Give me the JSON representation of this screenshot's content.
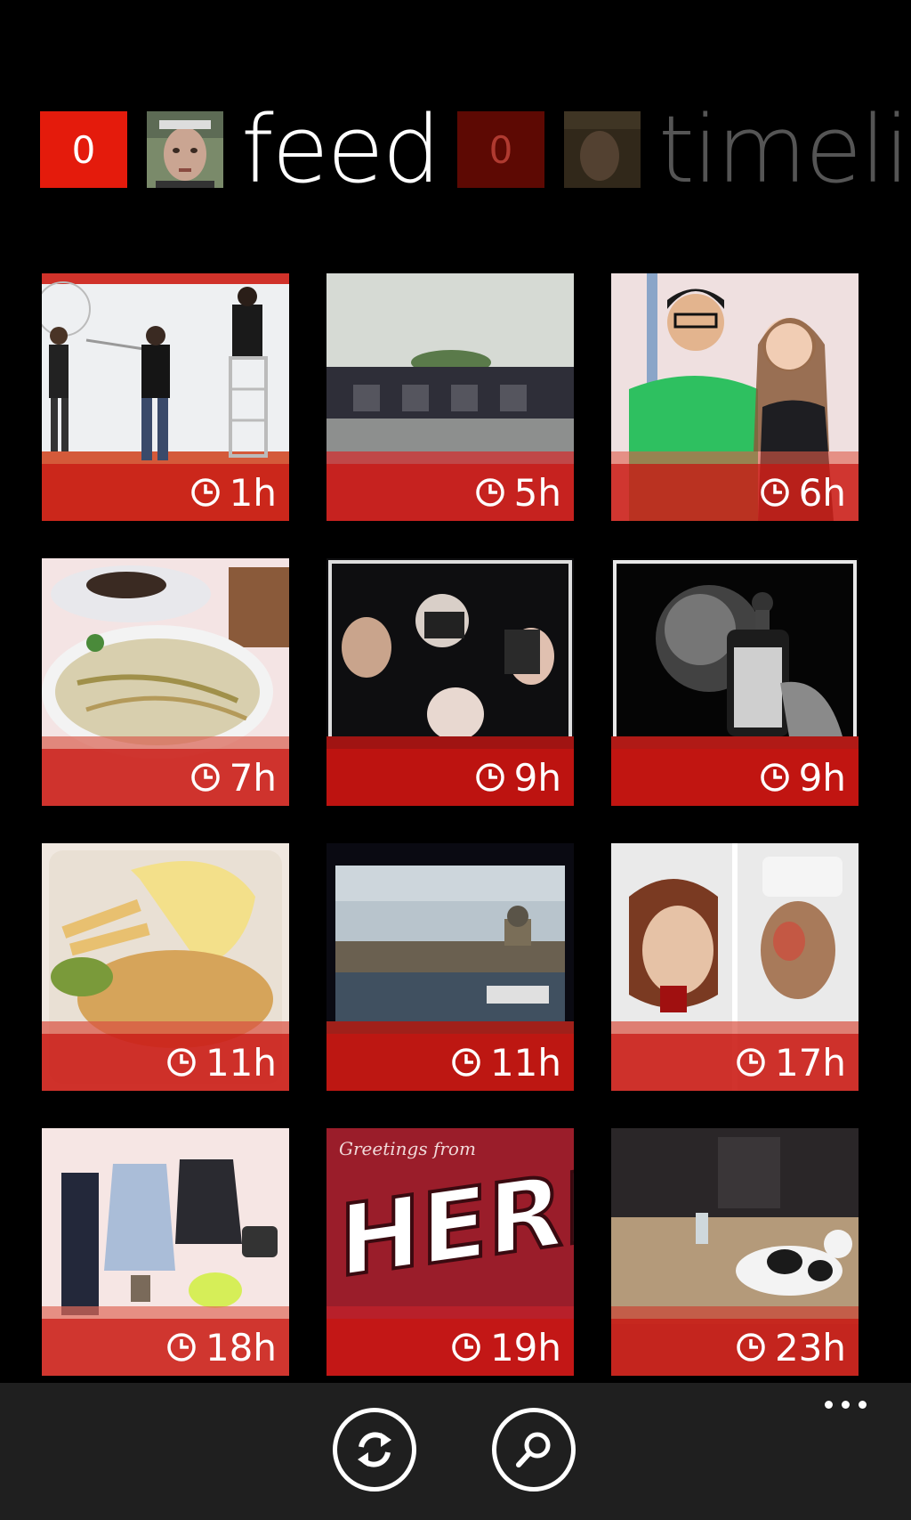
{
  "header": {
    "tabs": [
      {
        "label": "feed",
        "count": "0",
        "active": true
      },
      {
        "label": "timelin",
        "count": "0",
        "active": false
      }
    ]
  },
  "feed": {
    "photos": [
      {
        "age": "1h",
        "subject": "people painting a wall"
      },
      {
        "age": "5h",
        "subject": "rainy street with building"
      },
      {
        "age": "6h",
        "subject": "two friends posing with peace signs"
      },
      {
        "age": "7h",
        "subject": "bowl of noodle soup"
      },
      {
        "age": "9h",
        "subject": "people taking photos"
      },
      {
        "age": "9h",
        "subject": "hand holding phone"
      },
      {
        "age": "11h",
        "subject": "fish and chips with lemon"
      },
      {
        "age": "11h",
        "subject": "city waterfront"
      },
      {
        "age": "17h",
        "subject": "zombie makeup couple"
      },
      {
        "age": "18h",
        "subject": "clothing flat lay"
      },
      {
        "age": "19h",
        "subject": "Greetings from HERE postcard"
      },
      {
        "age": "23h",
        "subject": "dog lying on floor"
      }
    ],
    "postcard_text": {
      "script": "Greetings from",
      "big": "HERE"
    }
  },
  "appbar": {
    "refresh_icon": "refresh-icon",
    "search_icon": "search-icon",
    "more_icon": "more-icon"
  },
  "colors": {
    "accent": "#e41b0c",
    "stamp": "#c8140f",
    "appbar": "#1f1f1f"
  }
}
